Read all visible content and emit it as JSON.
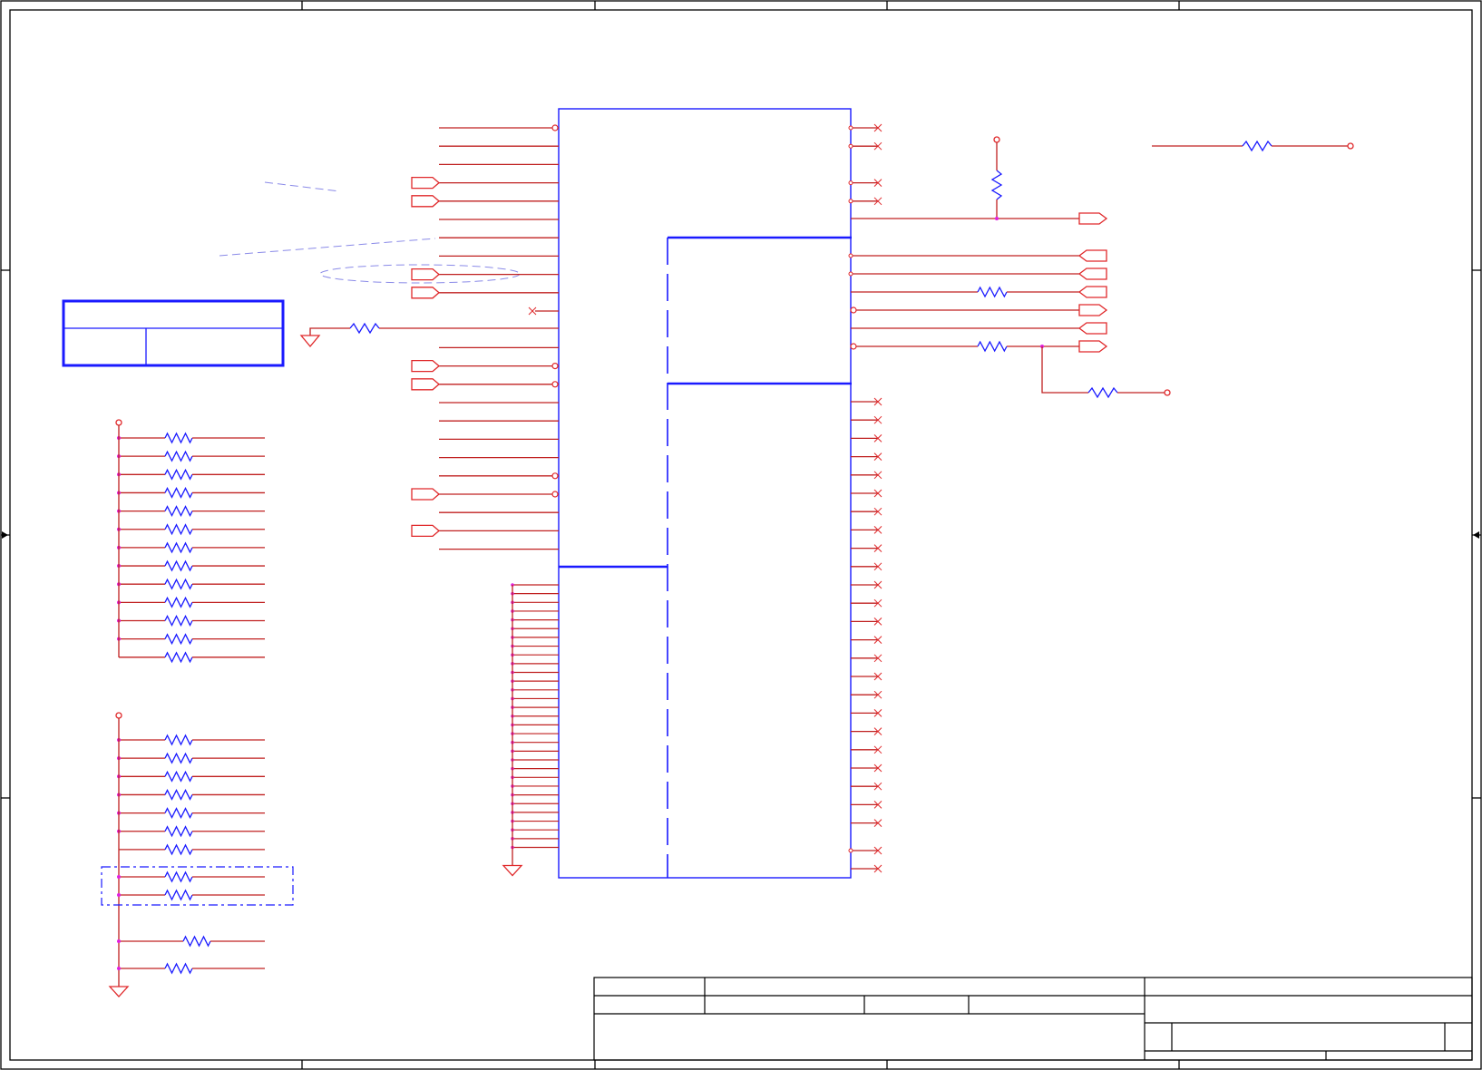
{
  "colors": {
    "wire": "#e0282a",
    "wire_dark": "#c02020",
    "part": "#1a1aff",
    "junction": "#e020e0",
    "frame": "#000000",
    "annotation": "#8a8ae8",
    "background": "#ffffff"
  },
  "chip_left_pins": {
    "count": 24,
    "port_in_rows": [
      3,
      4,
      8,
      9,
      13,
      14,
      20,
      22
    ],
    "open_circle_rows": [
      0,
      13,
      14,
      19,
      20
    ],
    "no_connect_rows": [
      10
    ],
    "resistor_to_ground_rows": [
      11
    ]
  },
  "chip_right_pins": {
    "count": 41,
    "no_connect_rows": [
      0,
      1,
      3,
      4,
      15,
      16,
      17,
      18,
      19,
      20,
      21,
      22,
      23,
      24,
      25,
      26,
      27,
      28,
      29,
      30,
      31,
      32,
      33,
      34,
      35,
      36,
      37,
      38,
      39,
      40
    ],
    "signal_rows": [
      5,
      7,
      8,
      9,
      10,
      11,
      12
    ]
  },
  "ground_pins": {
    "count": 31
  },
  "pull_resistor_banks": [
    {
      "name": "bank-upper",
      "count": 13
    },
    {
      "name": "bank-lower",
      "count": 7
    },
    {
      "name": "bank-boxed",
      "count": 2
    },
    {
      "name": "bank-bottom",
      "count": 2
    }
  ]
}
